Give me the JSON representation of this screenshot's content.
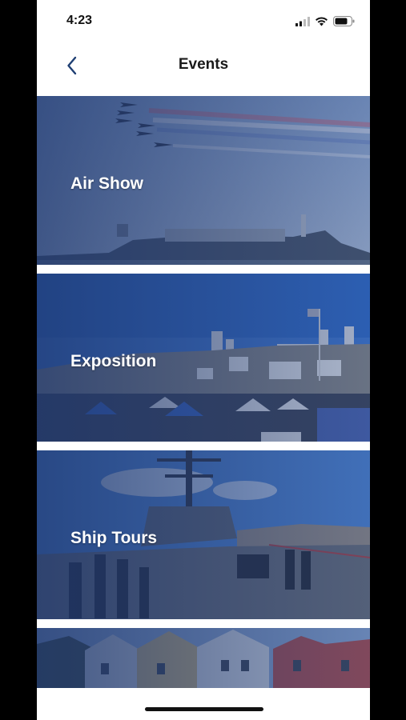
{
  "status_bar": {
    "time": "4:23",
    "icons": [
      "signal-icon",
      "wifi-icon",
      "battery-icon"
    ]
  },
  "nav": {
    "back_icon": "chevron-left-icon",
    "title": "Events",
    "accent_color": "#1f3f73"
  },
  "events": [
    {
      "label": "Air Show",
      "image": "air-show-photo"
    },
    {
      "label": "Exposition",
      "image": "exposition-photo"
    },
    {
      "label": "Ship Tours",
      "image": "ship-tours-photo"
    },
    {
      "label": "",
      "image": "victorian-houses-photo"
    }
  ]
}
